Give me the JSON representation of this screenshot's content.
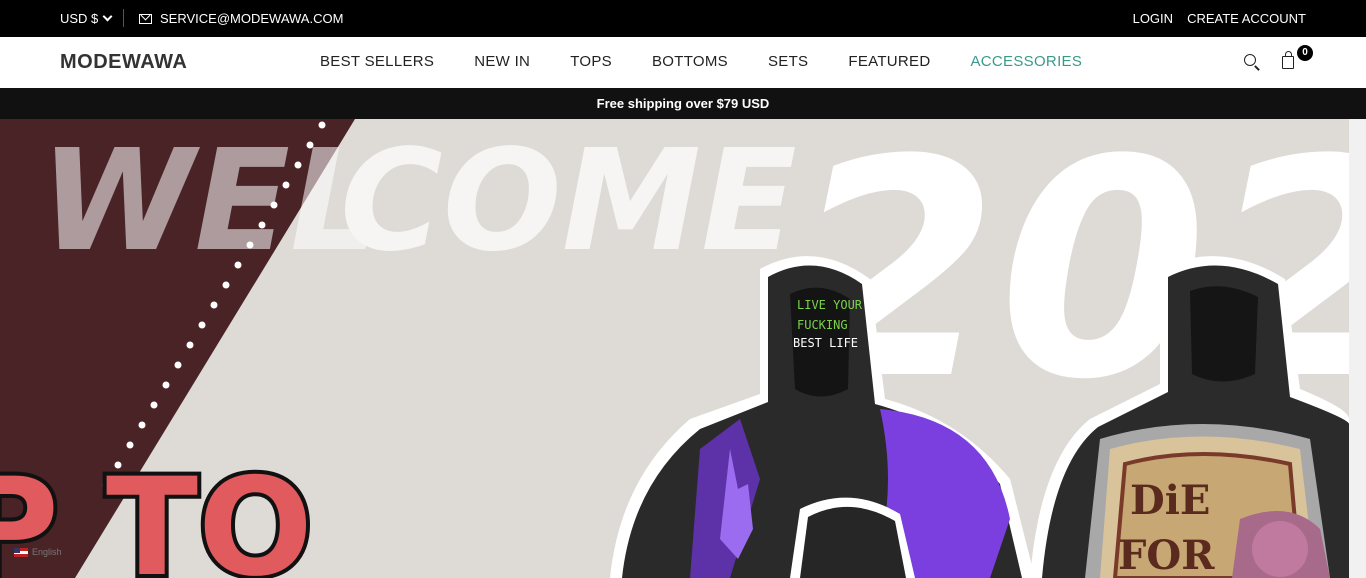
{
  "topbar": {
    "currency": "USD $",
    "email": "SERVICE@MODEWAWA.COM",
    "login": "LOGIN",
    "create_account": "CREATE ACCOUNT"
  },
  "header": {
    "logo": "MODEWAWA",
    "nav": [
      "BEST SELLERS",
      "NEW IN",
      "TOPS",
      "BOTTOMS",
      "SETS",
      "FEATURED",
      "ACCESSORIES"
    ],
    "cart_count": "0"
  },
  "announcement": "Free shipping over $79 USD",
  "hero": {
    "headline_left": "WEL",
    "headline_right": "COME",
    "headline_year": "202",
    "promo_text": "P TO",
    "hoodie_text": "LIVE YOUR FUCKING BEST LIFE",
    "patch_text": "DIE FOR"
  },
  "language": "English",
  "colors": {
    "accent": "#3a9a8a",
    "hero_dark": "#4a2326",
    "hero_bg": "#dedbd7",
    "promo_red": "#e05a5e"
  }
}
